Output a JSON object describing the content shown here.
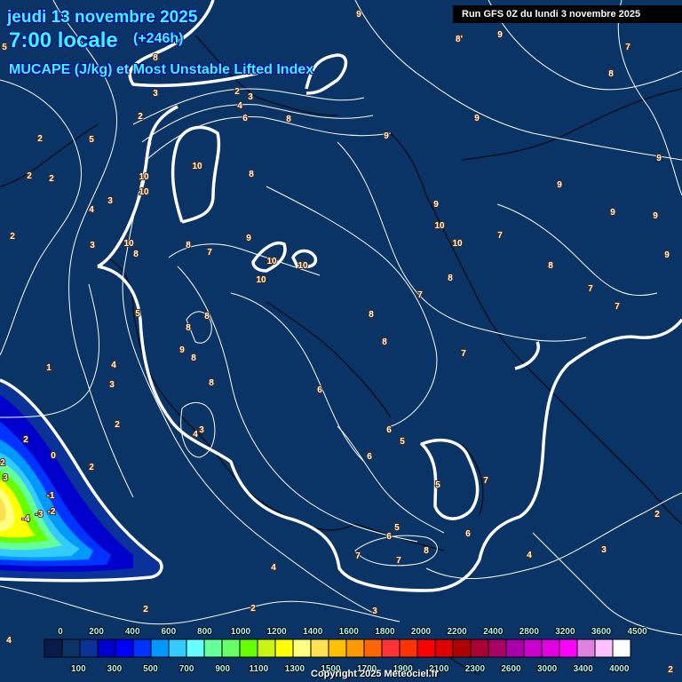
{
  "header": {
    "date": "jeudi 13 novembre 2025",
    "time": "7:00 locale",
    "lead": "(+246h)",
    "parameter": "MUCAPE (J/kg) et Most Unstable Lifted Index",
    "run": "Run GFS 0Z du lundi 3 novembre 2025"
  },
  "footer": {
    "copyright": "Copyright 2025 Meteociel.fr"
  },
  "colorbar": {
    "labels": [
      "0",
      "100",
      "200",
      "300",
      "400",
      "500",
      "600",
      "700",
      "800",
      "900",
      "1000",
      "1100",
      "1200",
      "1300",
      "1400",
      "1500",
      "1600",
      "1700",
      "1800",
      "1900",
      "2000",
      "2100",
      "2200",
      "2300",
      "2400",
      "2600",
      "2800",
      "3000",
      "3200",
      "3400",
      "3600",
      "4000",
      "4500"
    ],
    "colors": [
      "#0a1a4a",
      "#0a3366",
      "#0a3399",
      "#0000cc",
      "#0000ff",
      "#0033ff",
      "#0099ff",
      "#33ccff",
      "#66ffff",
      "#66ff99",
      "#66ff66",
      "#66ff00",
      "#c8f514",
      "#ffff00",
      "#ffff80",
      "#ffe050",
      "#ffc000",
      "#ff9900",
      "#ff6600",
      "#ff3333",
      "#ff3300",
      "#ff0000",
      "#e00000",
      "#b00000",
      "#aa0033",
      "#aa0066",
      "#aa00aa",
      "#cc00cc",
      "#e000e0",
      "#ff00ff",
      "#e080e0",
      "#ffc0ff",
      "#ffffff"
    ]
  },
  "contour_labels": [
    "5",
    "8",
    "9",
    "8'",
    "9",
    "7",
    "8",
    "3",
    "2",
    "2",
    "3",
    "4",
    "6",
    "8",
    "5",
    "2",
    "2",
    "2",
    "10",
    "8",
    "10",
    "10",
    "3",
    "4",
    "2",
    "3",
    "10",
    "8",
    "8",
    "7",
    "9",
    "10",
    "10",
    "10",
    "9",
    "9",
    "9",
    "9",
    "9",
    "10",
    "10",
    "7",
    "9",
    "9",
    "8",
    "8",
    "7",
    "7",
    "7",
    "9",
    "5",
    "8",
    "8",
    "8",
    "8",
    "7",
    "1",
    "4",
    "3",
    "9",
    "8",
    "8",
    "6",
    "2",
    "3",
    "4",
    "6",
    "5",
    "6",
    "2",
    "0",
    "-1",
    "2",
    "2",
    "3",
    "-4",
    "-3",
    "-2",
    "5",
    "7",
    "2",
    "5",
    "6",
    "6",
    "8",
    "7",
    "7",
    "4",
    "3",
    "4",
    "2",
    "2",
    "3",
    "4",
    "2"
  ]
}
